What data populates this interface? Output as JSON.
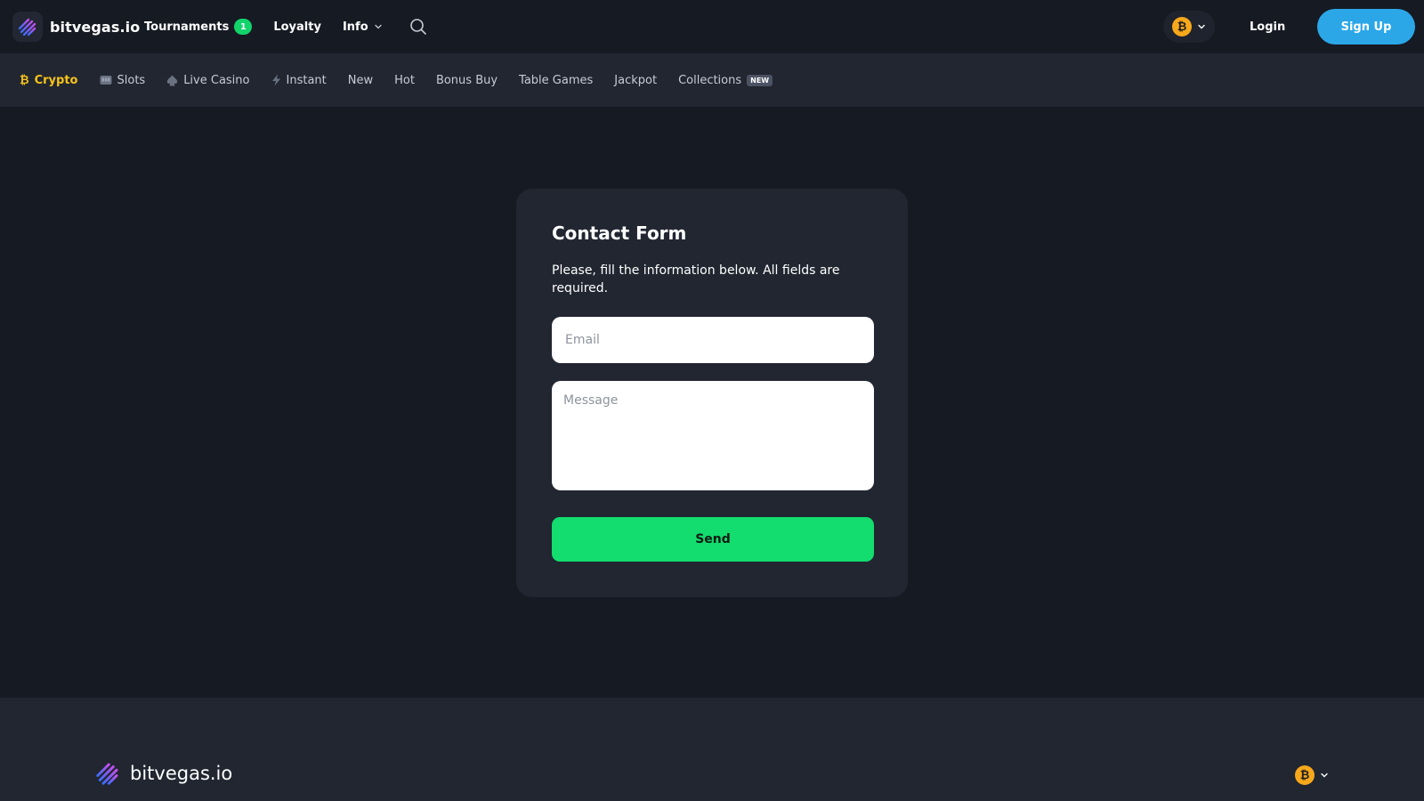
{
  "header": {
    "brand": "bitvegas.io",
    "nav": {
      "tournaments": "Tournaments",
      "tournaments_badge": "1",
      "loyalty": "Loyalty",
      "info": "Info"
    },
    "currency_symbol": "₿",
    "login_label": "Login",
    "signup_label": "Sign Up"
  },
  "categories": {
    "crypto": "Crypto",
    "slots": "Slots",
    "live_casino": "Live Casino",
    "instant": "Instant",
    "new": "New",
    "hot": "Hot",
    "bonus_buy": "Bonus Buy",
    "table_games": "Table Games",
    "jackpot": "Jackpot",
    "collections": "Collections",
    "collections_badge": "NEW"
  },
  "form": {
    "title": "Contact Form",
    "description": "Please, fill the information below. All fields are required.",
    "email_placeholder": "Email",
    "message_placeholder": "Message",
    "send_label": "Send"
  },
  "footer": {
    "brand": "bitvegas.io",
    "currency_symbol": "₿"
  },
  "colors": {
    "background": "#161a22",
    "panel": "#212631",
    "accent_blue": "#2ba7e8",
    "accent_green": "#12dd6e",
    "active_yellow": "#f7c31b",
    "bitcoin_orange": "#f7a81b"
  },
  "icons": {
    "logo": "striped-spade-logo-icon",
    "search": "search-icon",
    "chevron": "chevron-down-icon",
    "crypto": "bitcoin-icon",
    "slots": "slot-machine-icon",
    "live_casino": "spade-icon",
    "instant": "lightning-icon"
  }
}
